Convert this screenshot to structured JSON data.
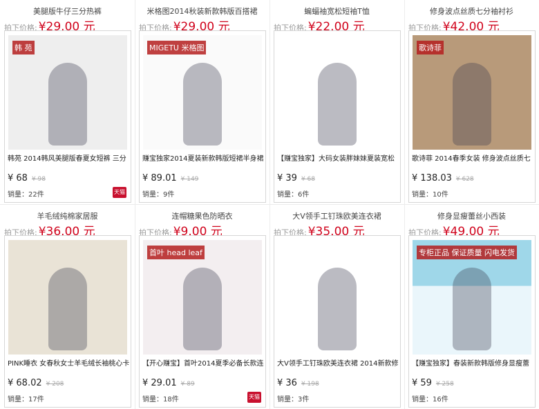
{
  "products": [
    {
      "title": "美腿版牛仔三分热裤",
      "price_label": "拍下价格:",
      "price": "¥29.00 元",
      "desc": "韩苑 2014韩风美腿版春夏女短裤 三分",
      "cur": "¥ 68",
      "old": "¥ 98",
      "sold": "销量：22件",
      "badge": "天猫",
      "img_text": "韩 苑"
    },
    {
      "title": "米格图2014秋装新款韩版百搭裙",
      "price_label": "拍下价格:",
      "price": "¥29.00 元",
      "desc": "赚宝独家2014夏装新款韩版短裙半身裙",
      "cur": "¥ 89.01",
      "old": "¥ 149",
      "sold": "销量：9件",
      "badge": "",
      "img_text": "MIGETU 米格图"
    },
    {
      "title": "蝙蝠袖宽松短袖T恤",
      "price_label": "拍下价格:",
      "price": "¥22.00 元",
      "desc": "【赚宝独家】大码女装胖妹妹夏装宽松",
      "cur": "¥ 39",
      "old": "¥ 68",
      "sold": "销量：6件",
      "badge": "",
      "img_text": ""
    },
    {
      "title": "修身波点丝质七分袖衬衫",
      "price_label": "拍下价格:",
      "price": "¥42.00 元",
      "desc": "歌诗菲 2014春季女装 修身波点丝质七",
      "cur": "¥ 138.03",
      "old": "¥ 628",
      "sold": "销量：10件",
      "badge": "",
      "img_text": "歌诗菲"
    },
    {
      "title": "羊毛绒纯棉家居服",
      "price_label": "拍下价格:",
      "price": "¥36.00 元",
      "desc": "PINK睡衣 女春秋女士羊毛绒长袖桃心卡",
      "cur": "¥ 68.02",
      "old": "¥ 208",
      "sold": "销量：17件",
      "badge": "",
      "img_text": ""
    },
    {
      "title": "连帽糖果色防晒衣",
      "price_label": "拍下价格:",
      "price": "¥9.00 元",
      "desc": "【开心赚宝】首叶2014夏季必备长款连",
      "cur": "¥ 29.01",
      "old": "¥ 89",
      "sold": "销量：18件",
      "badge": "天猫",
      "img_text": "首叶 head leaf"
    },
    {
      "title": "大V领手工钉珠欧美连衣裙",
      "price_label": "拍下价格:",
      "price": "¥35.00 元",
      "desc": "大V领手工钉珠欧美连衣裙 2014新款修",
      "cur": "¥ 36",
      "old": "¥ 198",
      "sold": "销量：3件",
      "badge": "",
      "img_text": ""
    },
    {
      "title": "修身显瘦蕾丝小西装",
      "price_label": "拍下价格:",
      "price": "¥49.00 元",
      "desc": "【赚宝独家】春装新款韩版修身显瘦蕾",
      "cur": "¥ 59",
      "old": "¥ 258",
      "sold": "销量：16件",
      "badge": "",
      "img_text": "专柜正品 保证质量 闪电发货"
    }
  ],
  "colors": {
    "price": "#d0021b",
    "badge": "#c8102e"
  }
}
